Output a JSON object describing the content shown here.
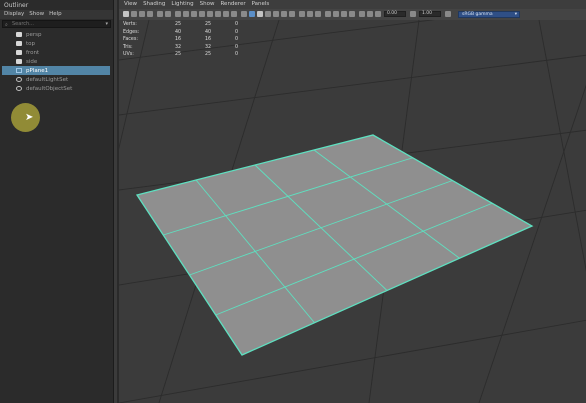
{
  "outliner": {
    "title": "Outliner",
    "menu": [
      "Display",
      "Show",
      "Help"
    ],
    "search_placeholder": "Search...",
    "items": [
      {
        "label": "persp",
        "type": "camera",
        "selected": false
      },
      {
        "label": "top",
        "type": "camera",
        "selected": false
      },
      {
        "label": "front",
        "type": "camera",
        "selected": false
      },
      {
        "label": "side",
        "type": "camera",
        "selected": false
      },
      {
        "label": "pPlane1",
        "type": "mesh",
        "selected": true
      },
      {
        "label": "defaultLightSet",
        "type": "set",
        "selected": false
      },
      {
        "label": "defaultObjectSet",
        "type": "set",
        "selected": false
      }
    ]
  },
  "viewport": {
    "menu": [
      "View",
      "Shading",
      "Lighting",
      "Show",
      "Renderer",
      "Panels"
    ],
    "toolbar": {
      "field_1": "0.00",
      "field_2": "1.00",
      "camera_select": "sRGB gamma"
    },
    "hud": {
      "rows": [
        {
          "label": "Verts:",
          "v1": "25",
          "v2": "25",
          "v3": "0"
        },
        {
          "label": "Edges:",
          "v1": "40",
          "v2": "40",
          "v3": "0"
        },
        {
          "label": "Faces:",
          "v1": "16",
          "v2": "16",
          "v3": "0"
        },
        {
          "label": "Tris:",
          "v1": "32",
          "v2": "32",
          "v3": "0"
        },
        {
          "label": "UVs:",
          "v1": "25",
          "v2": "25",
          "v3": "0"
        }
      ]
    },
    "scene": {
      "plane_subdivisions": 4,
      "background_color": "#3b3b3b",
      "grid_color": "#2c2c2c",
      "plane_fill": "#8f8f8f",
      "wire_color": "#5ee0c0"
    }
  },
  "colors": {
    "selection": "#5285a6",
    "cursor_halo": "#c8be3c"
  }
}
